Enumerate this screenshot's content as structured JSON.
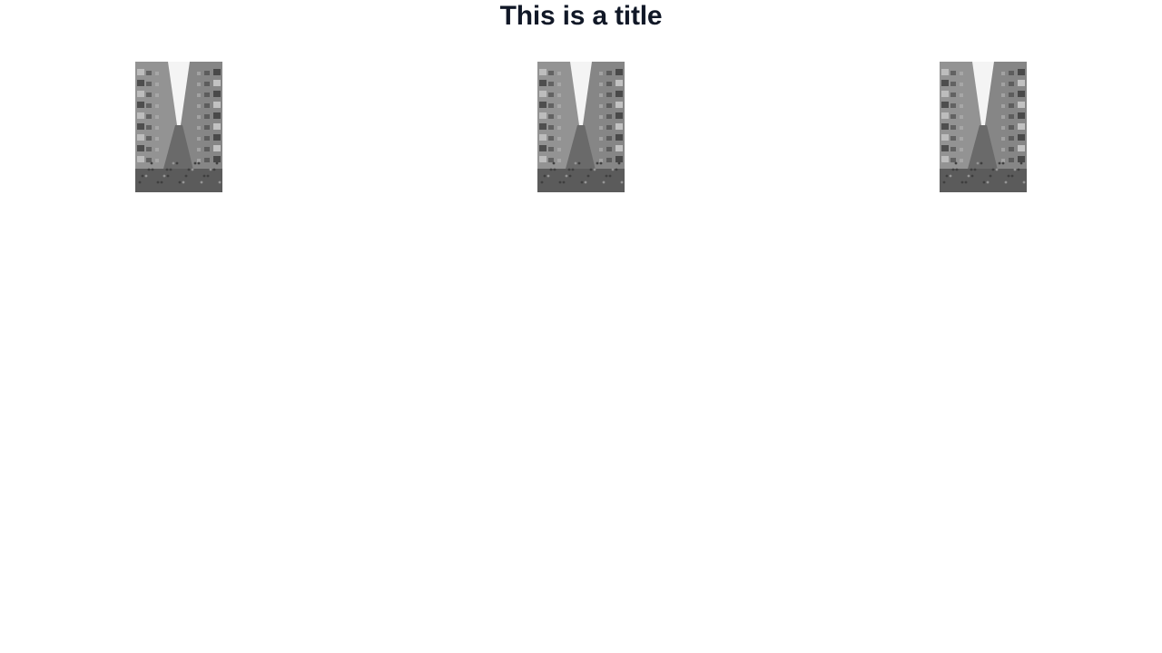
{
  "page": {
    "title": "This is a title"
  },
  "gallery": {
    "images": [
      {
        "icon": "street-photo-image",
        "description_color": "#7a7a7a"
      },
      {
        "icon": "street-photo-image",
        "description_color": "#7a7a7a"
      },
      {
        "icon": "street-photo-image",
        "description_color": "#7a7a7a"
      }
    ]
  },
  "colors": {
    "title": "#111827",
    "background": "#ffffff"
  }
}
